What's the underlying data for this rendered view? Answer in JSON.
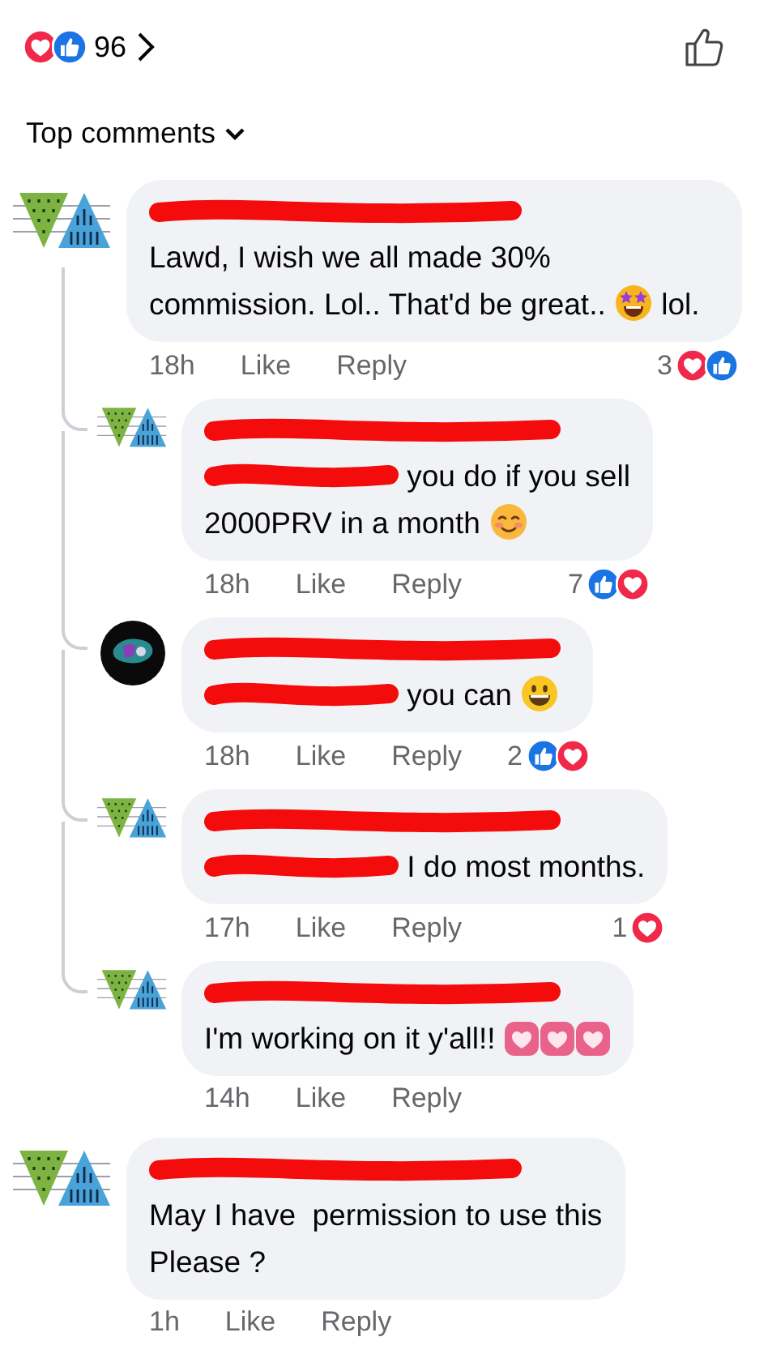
{
  "header": {
    "reactions": [
      {
        "kind": "love"
      },
      {
        "kind": "like"
      }
    ],
    "count": "96"
  },
  "sort": {
    "label": "Top comments"
  },
  "comments": [
    {
      "avatar": {
        "kind": "triangles"
      },
      "author_redacted": true,
      "segments": [
        {
          "kind": "text",
          "text": "Lawd, I wish we all made 30% commission. Lol.. That'd be great.. "
        },
        {
          "kind": "star-eyes"
        },
        {
          "kind": "text",
          "text": " lol."
        }
      ],
      "time": "18h",
      "like": "Like",
      "reply": "Reply",
      "reaction_count": "3",
      "reactions": [
        {
          "kind": "love"
        },
        {
          "kind": "like"
        }
      ],
      "replies": [
        {
          "avatar": {
            "kind": "triangles"
          },
          "author_redacted": true,
          "segments": [
            {
              "kind": "redaction"
            },
            {
              "kind": "text",
              "text": " you do if you sell"
            },
            {
              "kind": "break"
            },
            {
              "kind": "text",
              "text": "2000PRV in a month "
            },
            {
              "kind": "blush"
            }
          ],
          "time": "18h",
          "like": "Like",
          "reply": "Reply",
          "reaction_count": "7",
          "reactions": [
            {
              "kind": "like"
            },
            {
              "kind": "love"
            }
          ]
        },
        {
          "avatar": {
            "kind": "dark-circle"
          },
          "author_redacted": true,
          "segments": [
            {
              "kind": "redaction"
            },
            {
              "kind": "text",
              "text": " you can "
            },
            {
              "kind": "grin"
            }
          ],
          "time": "18h",
          "like": "Like",
          "reply": "Reply",
          "reaction_count": "2",
          "reactions": [
            {
              "kind": "like"
            },
            {
              "kind": "love"
            }
          ]
        },
        {
          "avatar": {
            "kind": "triangles"
          },
          "author_redacted": true,
          "segments": [
            {
              "kind": "redaction"
            },
            {
              "kind": "text",
              "text": " I do most months."
            }
          ],
          "time": "17h",
          "like": "Like",
          "reply": "Reply",
          "reaction_count": "1",
          "reactions": [
            {
              "kind": "love"
            }
          ]
        },
        {
          "avatar": {
            "kind": "triangles"
          },
          "author_redacted": true,
          "segments": [
            {
              "kind": "text",
              "text": "I'm working on it y'all!! "
            },
            {
              "kind": "heart"
            },
            {
              "kind": "heart"
            },
            {
              "kind": "heart"
            }
          ],
          "time": "14h",
          "like": "Like",
          "reply": "Reply"
        }
      ]
    },
    {
      "avatar": {
        "kind": "triangles"
      },
      "author_redacted": true,
      "segments": [
        {
          "kind": "text",
          "text": "May I have  permission to use this\nPlease ?"
        }
      ],
      "time": "1h",
      "like": "Like",
      "reply": "Reply"
    }
  ]
}
